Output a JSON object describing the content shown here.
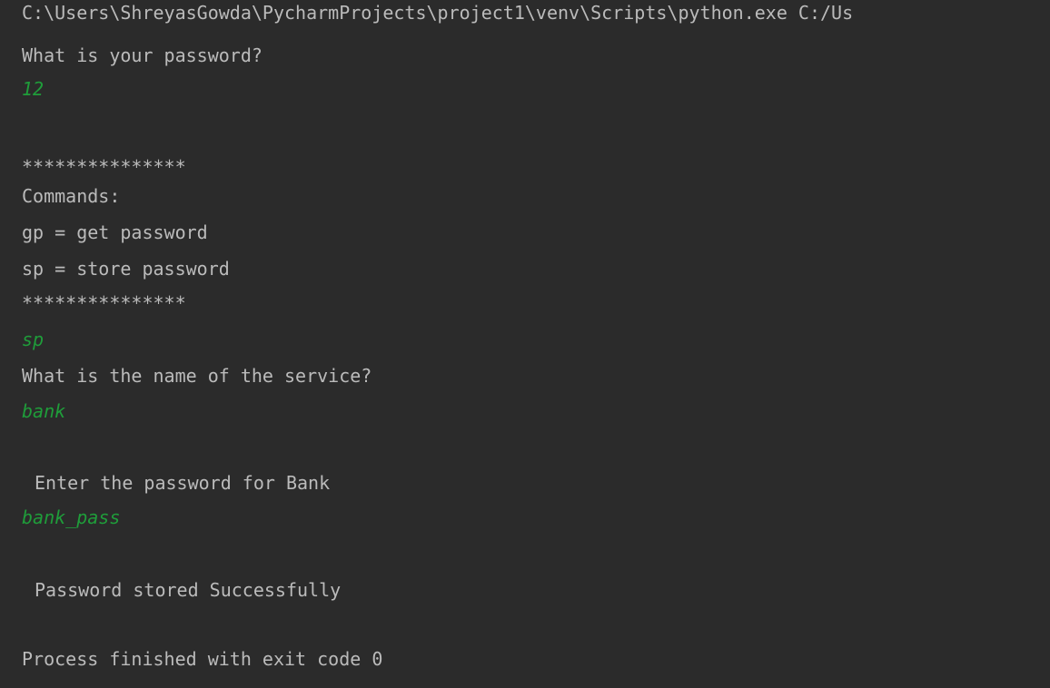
{
  "console": {
    "text_color": "#bbbbbb",
    "input_color": "#1f9d3a",
    "background": "#2b2b2b",
    "lines": [
      {
        "text": "C:\\Users\\ShreyasGowda\\PycharmProjects\\project1\\venv\\Scripts\\python.exe C:/Us",
        "kind": "output"
      },
      {
        "text": "What is your password?",
        "kind": "output"
      },
      {
        "text": "12",
        "kind": "input"
      },
      {
        "text": "***************",
        "kind": "output"
      },
      {
        "text": "Commands:",
        "kind": "output"
      },
      {
        "text": "gp = get password",
        "kind": "output"
      },
      {
        "text": "sp = store password",
        "kind": "output"
      },
      {
        "text": "***************",
        "kind": "output"
      },
      {
        "text": "sp",
        "kind": "input"
      },
      {
        "text": "What is the name of the service?",
        "kind": "output"
      },
      {
        "text": "bank",
        "kind": "input"
      },
      {
        "text": "Enter the password for Bank",
        "kind": "output"
      },
      {
        "text": "bank_pass",
        "kind": "input"
      },
      {
        "text": "Password stored Successfully",
        "kind": "output"
      },
      {
        "text": "Process finished with exit code 0",
        "kind": "output"
      }
    ]
  }
}
